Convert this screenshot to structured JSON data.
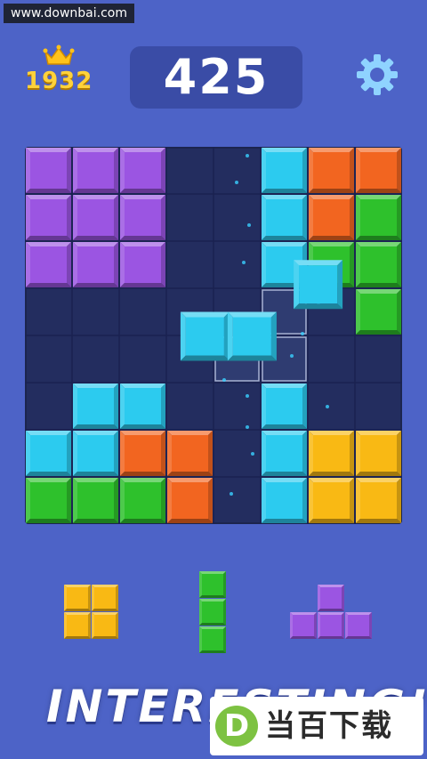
{
  "header": {
    "watermark": "www.downbai.com",
    "best_score": "1932",
    "score": "425",
    "crown_icon": "crown-icon",
    "settings_icon": "gear-icon"
  },
  "board": {
    "size": 8,
    "colors": {
      "P": "#9b55e2",
      "C": "#2ccbef",
      "O": "#f26520",
      "G": "#2ec12c",
      "Y": "#f9b914"
    },
    "grid": [
      "PPP..COO",
      "PPP..COG",
      "PPP..CGG",
      ".......G",
      "........",
      ".CC..C..",
      "CCOO.CYY",
      "GGGO.CYY"
    ],
    "dragging_piece": {
      "color": "C",
      "cells": [
        [
          5.7,
          2.4
        ],
        [
          3.3,
          3.5
        ],
        [
          4.3,
          3.5
        ]
      ],
      "ghost_cells": [
        [
          5,
          3
        ],
        [
          4,
          4
        ],
        [
          5,
          4
        ]
      ]
    }
  },
  "tray": {
    "pieces": [
      {
        "name": "square-yellow",
        "color": "Y",
        "cells": [
          [
            0,
            0
          ],
          [
            1,
            0
          ],
          [
            0,
            1
          ],
          [
            1,
            1
          ]
        ]
      },
      {
        "name": "line-green",
        "color": "G",
        "cells": [
          [
            0,
            0
          ],
          [
            0,
            1
          ],
          [
            0,
            2
          ]
        ]
      },
      {
        "name": "t-purple",
        "color": "P",
        "cells": [
          [
            1,
            0
          ],
          [
            0,
            1
          ],
          [
            1,
            1
          ],
          [
            2,
            1
          ]
        ]
      }
    ]
  },
  "footer": {
    "slogan": "INTERESTING!",
    "logo_letter": "D",
    "logo_text": "当百下载"
  }
}
